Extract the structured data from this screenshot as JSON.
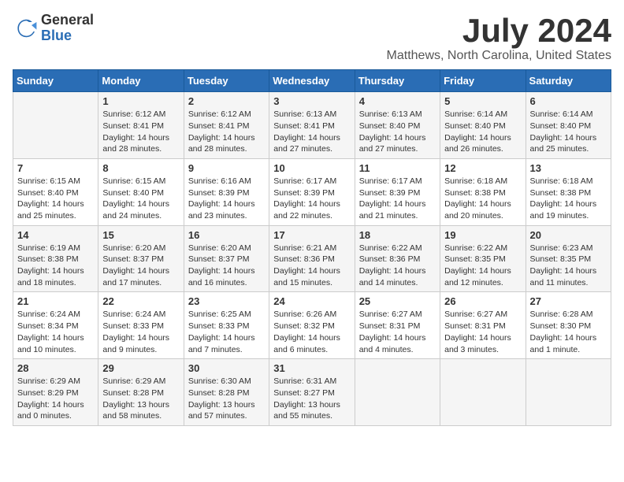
{
  "logo": {
    "general": "General",
    "blue": "Blue"
  },
  "header": {
    "title": "July 2024",
    "subtitle": "Matthews, North Carolina, United States"
  },
  "calendar": {
    "days_of_week": [
      "Sunday",
      "Monday",
      "Tuesday",
      "Wednesday",
      "Thursday",
      "Friday",
      "Saturday"
    ],
    "weeks": [
      [
        {
          "day": "",
          "sunrise": "",
          "sunset": "",
          "daylight": ""
        },
        {
          "day": "1",
          "sunrise": "Sunrise: 6:12 AM",
          "sunset": "Sunset: 8:41 PM",
          "daylight": "Daylight: 14 hours and 28 minutes."
        },
        {
          "day": "2",
          "sunrise": "Sunrise: 6:12 AM",
          "sunset": "Sunset: 8:41 PM",
          "daylight": "Daylight: 14 hours and 28 minutes."
        },
        {
          "day": "3",
          "sunrise": "Sunrise: 6:13 AM",
          "sunset": "Sunset: 8:41 PM",
          "daylight": "Daylight: 14 hours and 27 minutes."
        },
        {
          "day": "4",
          "sunrise": "Sunrise: 6:13 AM",
          "sunset": "Sunset: 8:40 PM",
          "daylight": "Daylight: 14 hours and 27 minutes."
        },
        {
          "day": "5",
          "sunrise": "Sunrise: 6:14 AM",
          "sunset": "Sunset: 8:40 PM",
          "daylight": "Daylight: 14 hours and 26 minutes."
        },
        {
          "day": "6",
          "sunrise": "Sunrise: 6:14 AM",
          "sunset": "Sunset: 8:40 PM",
          "daylight": "Daylight: 14 hours and 25 minutes."
        }
      ],
      [
        {
          "day": "7",
          "sunrise": "Sunrise: 6:15 AM",
          "sunset": "Sunset: 8:40 PM",
          "daylight": "Daylight: 14 hours and 25 minutes."
        },
        {
          "day": "8",
          "sunrise": "Sunrise: 6:15 AM",
          "sunset": "Sunset: 8:40 PM",
          "daylight": "Daylight: 14 hours and 24 minutes."
        },
        {
          "day": "9",
          "sunrise": "Sunrise: 6:16 AM",
          "sunset": "Sunset: 8:39 PM",
          "daylight": "Daylight: 14 hours and 23 minutes."
        },
        {
          "day": "10",
          "sunrise": "Sunrise: 6:17 AM",
          "sunset": "Sunset: 8:39 PM",
          "daylight": "Daylight: 14 hours and 22 minutes."
        },
        {
          "day": "11",
          "sunrise": "Sunrise: 6:17 AM",
          "sunset": "Sunset: 8:39 PM",
          "daylight": "Daylight: 14 hours and 21 minutes."
        },
        {
          "day": "12",
          "sunrise": "Sunrise: 6:18 AM",
          "sunset": "Sunset: 8:38 PM",
          "daylight": "Daylight: 14 hours and 20 minutes."
        },
        {
          "day": "13",
          "sunrise": "Sunrise: 6:18 AM",
          "sunset": "Sunset: 8:38 PM",
          "daylight": "Daylight: 14 hours and 19 minutes."
        }
      ],
      [
        {
          "day": "14",
          "sunrise": "Sunrise: 6:19 AM",
          "sunset": "Sunset: 8:38 PM",
          "daylight": "Daylight: 14 hours and 18 minutes."
        },
        {
          "day": "15",
          "sunrise": "Sunrise: 6:20 AM",
          "sunset": "Sunset: 8:37 PM",
          "daylight": "Daylight: 14 hours and 17 minutes."
        },
        {
          "day": "16",
          "sunrise": "Sunrise: 6:20 AM",
          "sunset": "Sunset: 8:37 PM",
          "daylight": "Daylight: 14 hours and 16 minutes."
        },
        {
          "day": "17",
          "sunrise": "Sunrise: 6:21 AM",
          "sunset": "Sunset: 8:36 PM",
          "daylight": "Daylight: 14 hours and 15 minutes."
        },
        {
          "day": "18",
          "sunrise": "Sunrise: 6:22 AM",
          "sunset": "Sunset: 8:36 PM",
          "daylight": "Daylight: 14 hours and 14 minutes."
        },
        {
          "day": "19",
          "sunrise": "Sunrise: 6:22 AM",
          "sunset": "Sunset: 8:35 PM",
          "daylight": "Daylight: 14 hours and 12 minutes."
        },
        {
          "day": "20",
          "sunrise": "Sunrise: 6:23 AM",
          "sunset": "Sunset: 8:35 PM",
          "daylight": "Daylight: 14 hours and 11 minutes."
        }
      ],
      [
        {
          "day": "21",
          "sunrise": "Sunrise: 6:24 AM",
          "sunset": "Sunset: 8:34 PM",
          "daylight": "Daylight: 14 hours and 10 minutes."
        },
        {
          "day": "22",
          "sunrise": "Sunrise: 6:24 AM",
          "sunset": "Sunset: 8:33 PM",
          "daylight": "Daylight: 14 hours and 9 minutes."
        },
        {
          "day": "23",
          "sunrise": "Sunrise: 6:25 AM",
          "sunset": "Sunset: 8:33 PM",
          "daylight": "Daylight: 14 hours and 7 minutes."
        },
        {
          "day": "24",
          "sunrise": "Sunrise: 6:26 AM",
          "sunset": "Sunset: 8:32 PM",
          "daylight": "Daylight: 14 hours and 6 minutes."
        },
        {
          "day": "25",
          "sunrise": "Sunrise: 6:27 AM",
          "sunset": "Sunset: 8:31 PM",
          "daylight": "Daylight: 14 hours and 4 minutes."
        },
        {
          "day": "26",
          "sunrise": "Sunrise: 6:27 AM",
          "sunset": "Sunset: 8:31 PM",
          "daylight": "Daylight: 14 hours and 3 minutes."
        },
        {
          "day": "27",
          "sunrise": "Sunrise: 6:28 AM",
          "sunset": "Sunset: 8:30 PM",
          "daylight": "Daylight: 14 hours and 1 minute."
        }
      ],
      [
        {
          "day": "28",
          "sunrise": "Sunrise: 6:29 AM",
          "sunset": "Sunset: 8:29 PM",
          "daylight": "Daylight: 14 hours and 0 minutes."
        },
        {
          "day": "29",
          "sunrise": "Sunrise: 6:29 AM",
          "sunset": "Sunset: 8:28 PM",
          "daylight": "Daylight: 13 hours and 58 minutes."
        },
        {
          "day": "30",
          "sunrise": "Sunrise: 6:30 AM",
          "sunset": "Sunset: 8:28 PM",
          "daylight": "Daylight: 13 hours and 57 minutes."
        },
        {
          "day": "31",
          "sunrise": "Sunrise: 6:31 AM",
          "sunset": "Sunset: 8:27 PM",
          "daylight": "Daylight: 13 hours and 55 minutes."
        },
        {
          "day": "",
          "sunrise": "",
          "sunset": "",
          "daylight": ""
        },
        {
          "day": "",
          "sunrise": "",
          "sunset": "",
          "daylight": ""
        },
        {
          "day": "",
          "sunrise": "",
          "sunset": "",
          "daylight": ""
        }
      ]
    ]
  }
}
